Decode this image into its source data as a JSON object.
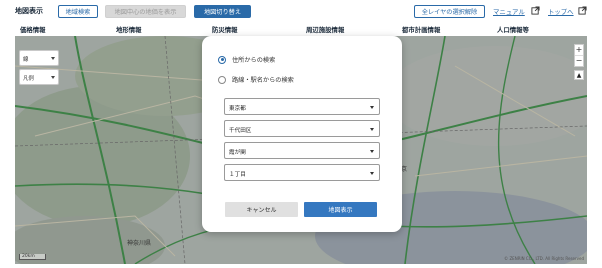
{
  "toolbar": {
    "title": "地図表示",
    "area_search": "地域検索",
    "show_center_price": "地図中心の地価を表示",
    "switch_map": "地図切り替え",
    "clear_all_layers": "全レイヤの選択解除",
    "manual": "マニュアル",
    "top": "トップへ"
  },
  "categories": [
    "価格情報",
    "地形情報",
    "防災情報",
    "周辺施設情報",
    "都市計画情報",
    "人口情報等"
  ],
  "map": {
    "select_1": "線",
    "select_2": "凡例",
    "labels": [
      "神奈川県",
      "東京"
    ],
    "scale": "20km",
    "copyright": "© ZENRIN CO., LTD. All Rights Reserved"
  },
  "modal": {
    "radio_address": "住所からの検索",
    "radio_station": "路線・駅名からの検索",
    "radio_selected": "address",
    "selects": [
      "東京都",
      "千代田区",
      "霞が関",
      "１丁目"
    ],
    "cancel": "キャンセル",
    "show_map": "地図表示"
  },
  "colors": {
    "accent": "#2a6aa8",
    "primary_button": "#3578c0",
    "map_base": "#b9c4be",
    "road_green": "#3e9b4a"
  }
}
